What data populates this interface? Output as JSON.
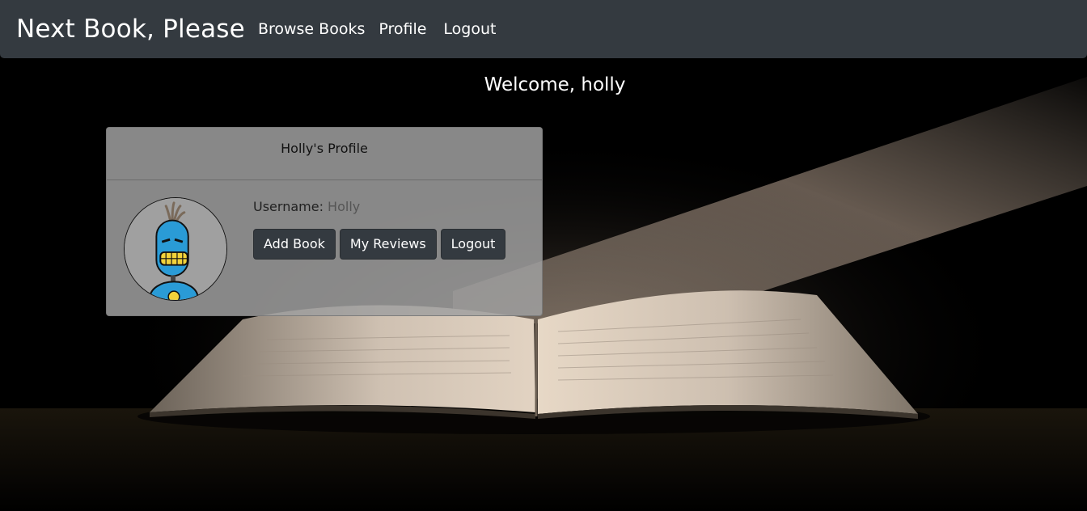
{
  "navbar": {
    "brand": "Next Book, Please",
    "links": [
      "Browse Books",
      "Profile",
      "Logout"
    ]
  },
  "welcome": "Welcome, holly",
  "profile_card": {
    "title": "Holly's Profile",
    "username_label": "Username:",
    "username_value": "Holly",
    "buttons": {
      "add_book": "Add Book",
      "my_reviews": "My Reviews",
      "logout": "Logout"
    }
  },
  "colors": {
    "navbar": "#343a40",
    "button": "#343a40",
    "card": "#a0a0a0",
    "robot_blue": "#2a9bd6"
  },
  "icons": {
    "avatar": "robot-avatar-icon",
    "background": "open-book-image"
  }
}
